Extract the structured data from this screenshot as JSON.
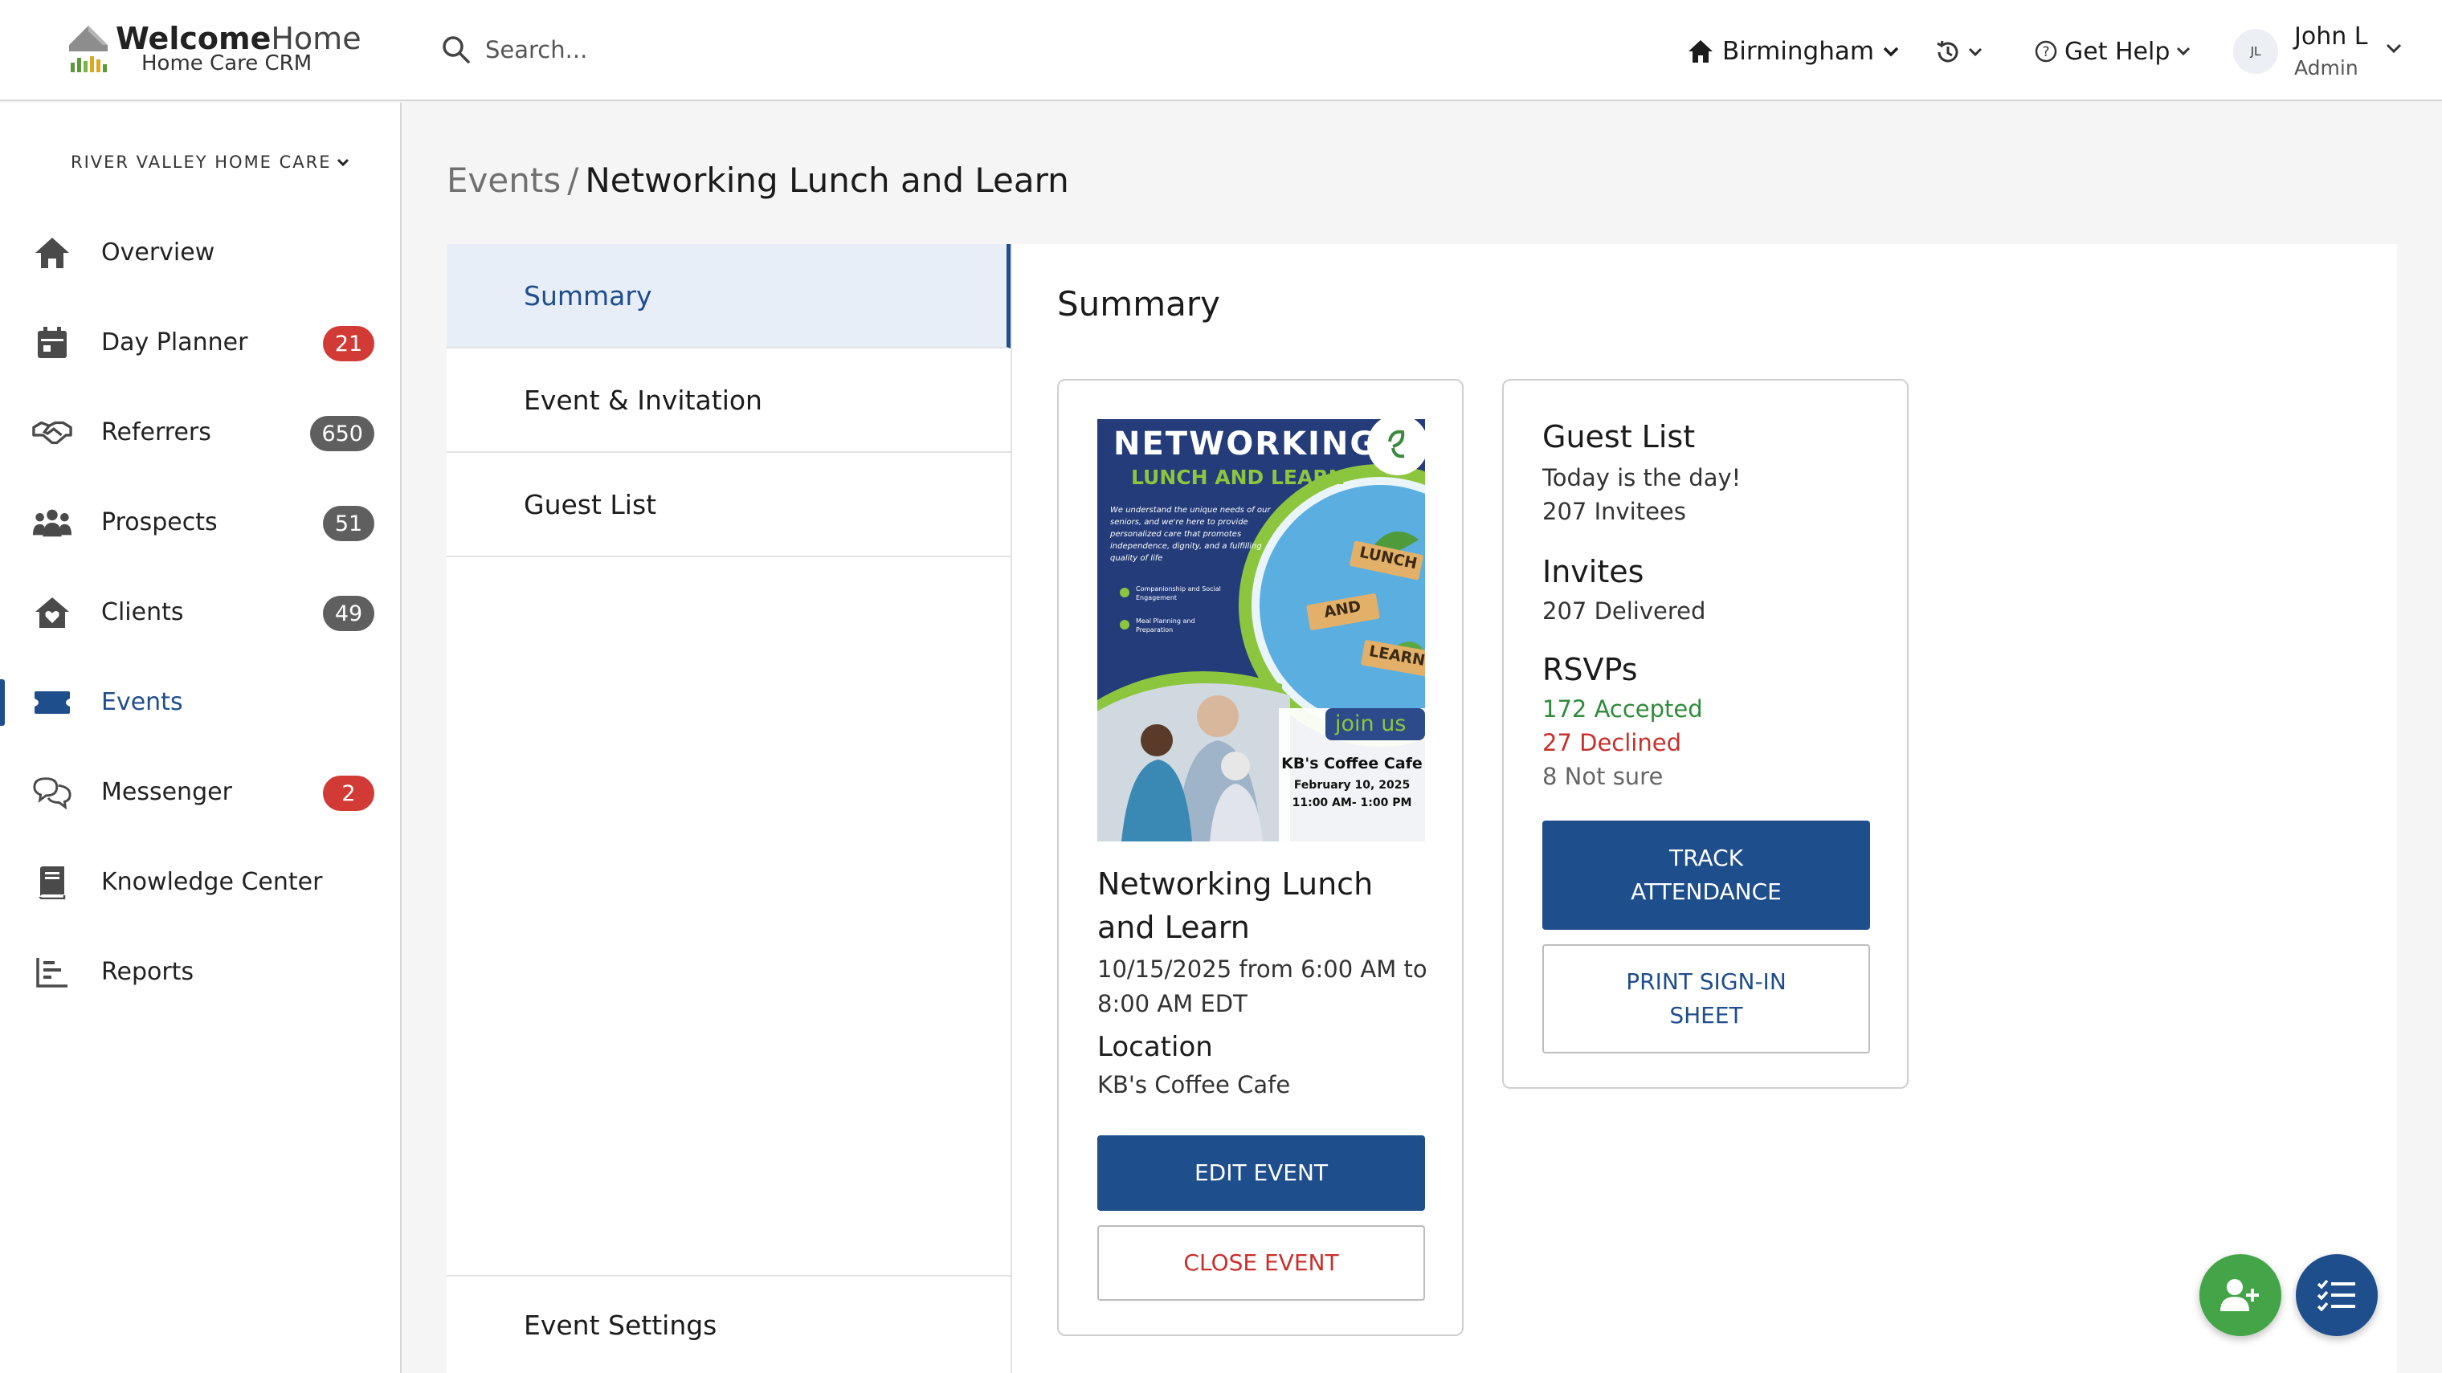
{
  "header": {
    "brand_bold": "Welcome",
    "brand_light": "Home",
    "brand_sub": "Home Care CRM",
    "search_placeholder": "Search...",
    "location": "Birmingham",
    "help_label": "Get Help",
    "user": {
      "initials": "JL",
      "name": "John L",
      "role": "Admin"
    }
  },
  "sidebar": {
    "org_name": "RIVER VALLEY HOME CARE",
    "items": [
      {
        "label": "Overview",
        "icon": "home-icon",
        "badge": null
      },
      {
        "label": "Day Planner",
        "icon": "calendar-icon",
        "badge": "21",
        "badge_color": "#d23a36"
      },
      {
        "label": "Referrers",
        "icon": "handshake-icon",
        "badge": "650",
        "badge_color": "#5f5f5f"
      },
      {
        "label": "Prospects",
        "icon": "people-icon",
        "badge": "51",
        "badge_color": "#5f5f5f"
      },
      {
        "label": "Clients",
        "icon": "house-heart-icon",
        "badge": "49",
        "badge_color": "#5f5f5f"
      },
      {
        "label": "Events",
        "icon": "ticket-icon",
        "badge": null,
        "active": true
      },
      {
        "label": "Messenger",
        "icon": "chat-icon",
        "badge": "2",
        "badge_color": "#d23a36"
      },
      {
        "label": "Knowledge Center",
        "icon": "book-icon",
        "badge": null
      },
      {
        "label": "Reports",
        "icon": "bar-chart-icon",
        "badge": null
      }
    ]
  },
  "breadcrumb": {
    "parent": "Events",
    "separator": "/",
    "current": "Networking Lunch and Learn"
  },
  "tabs": {
    "summary": "Summary",
    "event_invitation": "Event & Invitation",
    "guest_list": "Guest List",
    "event_settings": "Event Settings"
  },
  "panel": {
    "title": "Summary"
  },
  "event_card": {
    "flyer": {
      "title": "NETWORKING",
      "subtitle": "LUNCH AND LEARN",
      "blurb": "We understand the unique needs of our seniors, and we're here to provide personalized care that promotes independence, dignity, and a fulfilling quality of life",
      "bullet1": "Companionship and Social Engagement",
      "bullet2": "Meal Planning and Preparation",
      "block_lunch": "LUNCH",
      "block_and": "AND",
      "block_learn": "LEARN",
      "join": "join us",
      "venue": "KB's Coffee Cafe",
      "date": "February 10, 2025",
      "time": "11:00 AM- 1:00 PM"
    },
    "name": "Networking Lunch and Learn",
    "datetime": "10/15/2025 from 6:00 AM to 8:00 AM EDT",
    "location_heading": "Location",
    "location": "KB's Coffee Cafe",
    "edit_label": "EDIT EVENT",
    "close_label": "CLOSE EVENT"
  },
  "guest_card": {
    "heading": "Guest List",
    "today": "Today is the day!",
    "invitees": "207 Invitees",
    "invites_heading": "Invites",
    "delivered": "207 Delivered",
    "rsvps_heading": "RSVPs",
    "accepted": "172 Accepted",
    "declined": "27 Declined",
    "not_sure": "8 Not sure",
    "track_label": "TRACK ATTENDANCE",
    "print_label": "PRINT SIGN-IN SHEET"
  },
  "colors": {
    "primary": "#1f4e8c",
    "danger": "#c8302c",
    "success": "#2e8b3a",
    "fab_green": "#43a547"
  }
}
